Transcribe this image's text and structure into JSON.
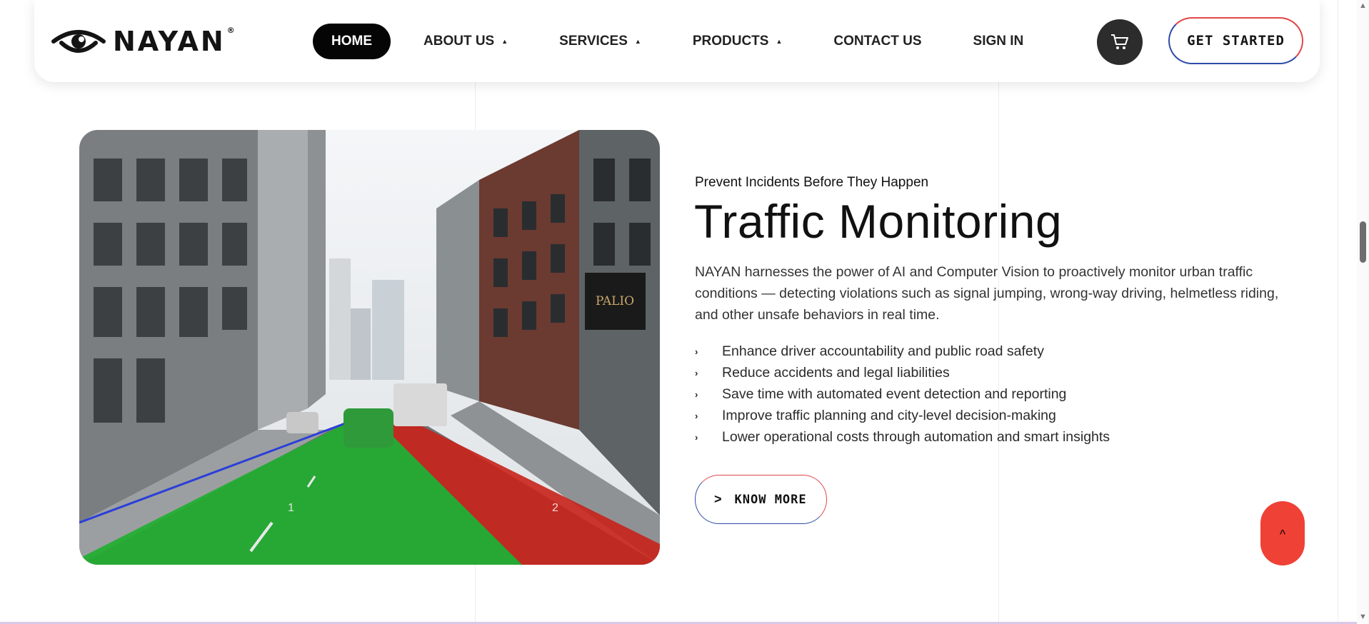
{
  "header": {
    "logo_text": "NAYAN",
    "logo_mark": "®",
    "nav": [
      {
        "label": "HOME",
        "active": true,
        "has_caret": false
      },
      {
        "label": "ABOUT US",
        "active": false,
        "has_caret": true
      },
      {
        "label": "SERVICES",
        "active": false,
        "has_caret": true
      },
      {
        "label": "PRODUCTS",
        "active": false,
        "has_caret": true
      },
      {
        "label": "CONTACT US",
        "active": false,
        "has_caret": false
      },
      {
        "label": "SIGN IN",
        "active": false,
        "has_caret": false
      }
    ],
    "caret_glyph": "▲",
    "cart_icon": "cart-icon",
    "cta_label": "GET STARTED"
  },
  "section": {
    "eyebrow": "Prevent Incidents Before They Happen",
    "title": "Traffic Monitoring",
    "description": "NAYAN harnesses the power of AI and Computer Vision to proactively monitor urban traffic conditions — detecting violations such as signal jumping, wrong-way driving, helmetless riding, and other unsafe behaviors in real time.",
    "bullets": [
      "Enhance driver accountability and public road safety",
      "Reduce accidents and legal liabilities",
      "Save time with automated event detection and reporting",
      "Improve traffic planning and city-level decision-making",
      "Lower operational costs through automation and smart insights"
    ],
    "bullet_glyph": "›",
    "button_label": "KNOW MORE",
    "button_glyph": ">",
    "image": {
      "lane_labels": [
        "1",
        "2"
      ],
      "sign_text": "PALIO"
    }
  },
  "scroll_top_glyph": "^",
  "scrollbar": {
    "up": "▲",
    "down": "▼"
  },
  "colors": {
    "accent_red": "#ef4136",
    "accent_blue": "#2d4ca8",
    "dark": "#050505",
    "lane_green": "#1fae2d",
    "lane_red": "#c8221a"
  }
}
